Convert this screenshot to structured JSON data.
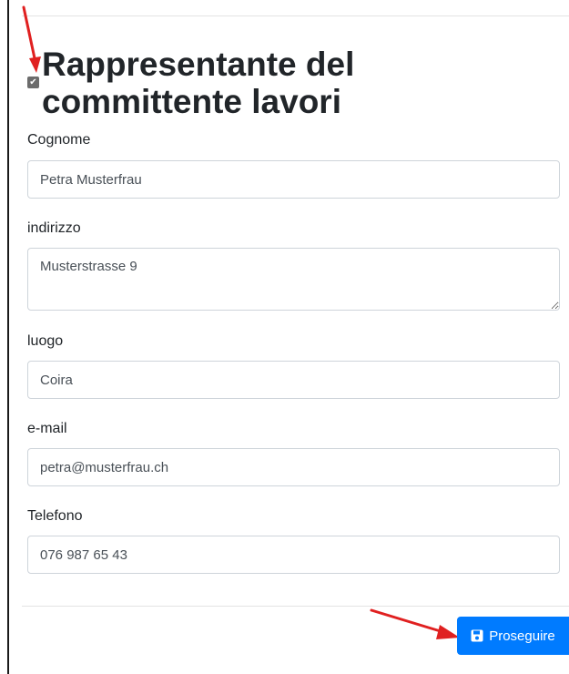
{
  "section": {
    "title": "Rappresentante del committente lavori",
    "checkbox_checked": true,
    "checkbox_mark": "✔"
  },
  "fields": {
    "cognome": {
      "label": "Cognome",
      "value": "Petra Musterfrau"
    },
    "indirizzo": {
      "label": "indirizzo",
      "value": "Musterstrasse 9"
    },
    "luogo": {
      "label": "luogo",
      "value": "Coira"
    },
    "email": {
      "label": "e-mail",
      "value": "petra@musterfrau.ch"
    },
    "telefono": {
      "label": "Telefono",
      "value": "076 987 65 43"
    }
  },
  "actions": {
    "submit_label": "Proseguire",
    "submit_icon": "save-icon"
  },
  "colors": {
    "primary": "#007bff",
    "annotation_arrow": "#e02020",
    "checkbox": "#6c6c6c"
  }
}
